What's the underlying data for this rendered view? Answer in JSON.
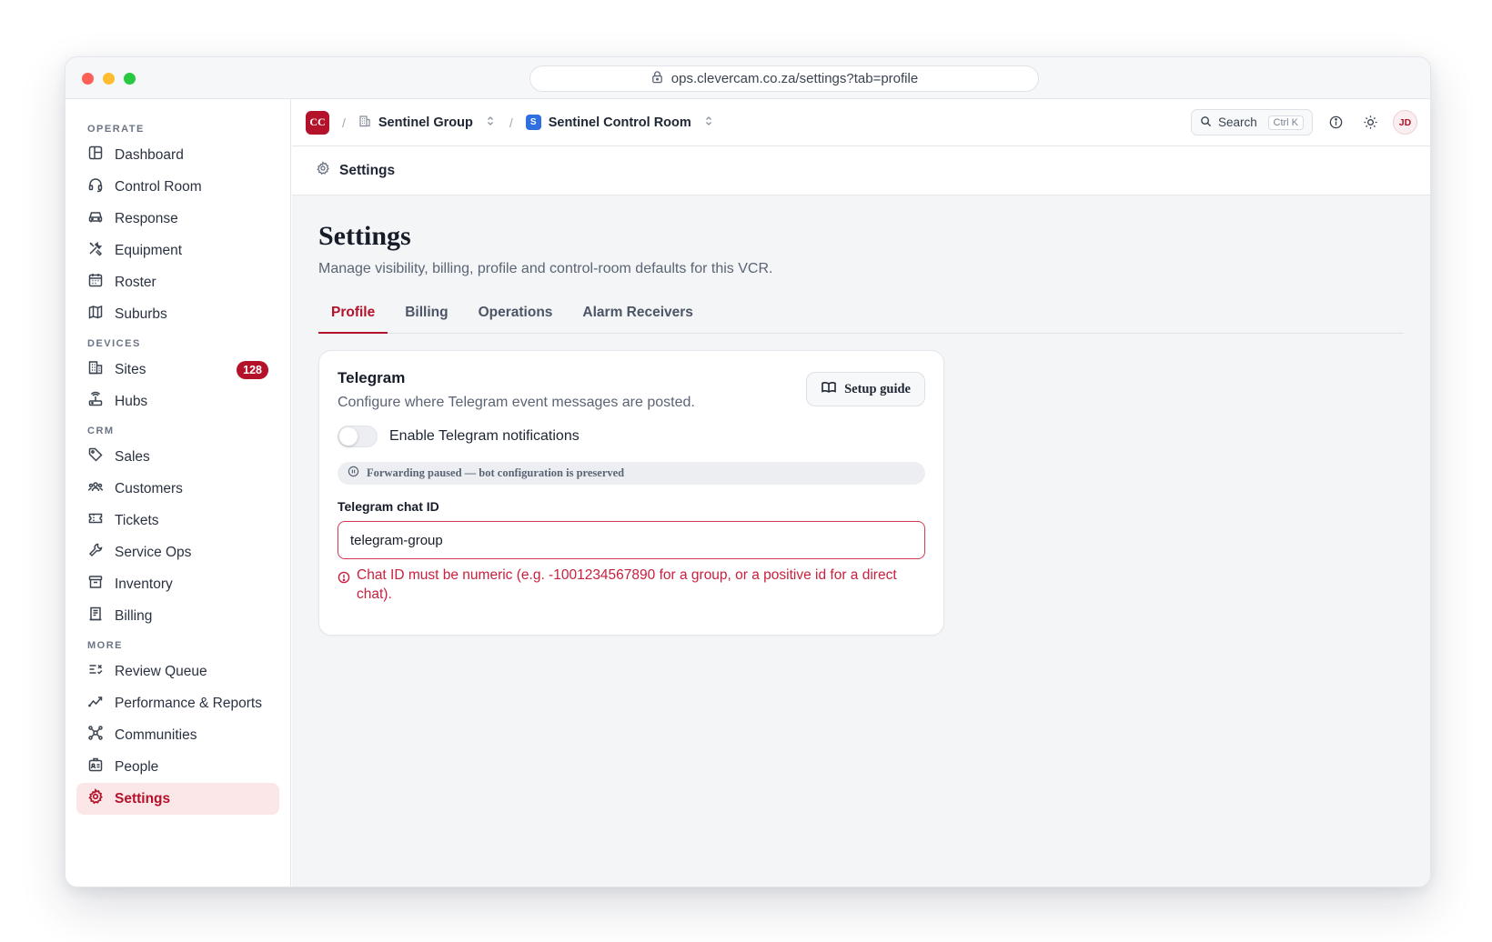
{
  "browser": {
    "url": "ops.clevercam.co.za/settings?tab=profile"
  },
  "sidebar": {
    "sections": [
      {
        "label": "OPERATE",
        "items": [
          {
            "label": "Dashboard",
            "icon": "dashboard-icon"
          },
          {
            "label": "Control Room",
            "icon": "headset-icon"
          },
          {
            "label": "Response",
            "icon": "car-icon"
          },
          {
            "label": "Equipment",
            "icon": "tools-icon"
          },
          {
            "label": "Roster",
            "icon": "calendar-icon"
          },
          {
            "label": "Suburbs",
            "icon": "map-icon"
          }
        ]
      },
      {
        "label": "DEVICES",
        "items": [
          {
            "label": "Sites",
            "icon": "building-icon",
            "badge": "128"
          },
          {
            "label": "Hubs",
            "icon": "router-icon"
          }
        ]
      },
      {
        "label": "CRM",
        "items": [
          {
            "label": "Sales",
            "icon": "tag-icon"
          },
          {
            "label": "Customers",
            "icon": "users-icon"
          },
          {
            "label": "Tickets",
            "icon": "ticket-icon"
          },
          {
            "label": "Service Ops",
            "icon": "wrench-icon"
          },
          {
            "label": "Inventory",
            "icon": "archive-icon"
          },
          {
            "label": "Billing",
            "icon": "receipt-icon"
          }
        ]
      },
      {
        "label": "MORE",
        "items": [
          {
            "label": "Review Queue",
            "icon": "list-check-icon"
          },
          {
            "label": "Performance & Reports",
            "icon": "trend-icon"
          },
          {
            "label": "Communities",
            "icon": "network-icon"
          },
          {
            "label": "People",
            "icon": "id-badge-icon"
          },
          {
            "label": "Settings",
            "icon": "gear-icon",
            "active": true
          }
        ]
      }
    ]
  },
  "topbar": {
    "org_logo": "CC",
    "org_name": "Sentinel Group",
    "room_logo": "S",
    "room_name": "Sentinel Control Room",
    "separator": "/",
    "search_label": "Search",
    "search_shortcut": "Ctrl K",
    "avatar_initials": "JD"
  },
  "pagebar": {
    "title": "Settings"
  },
  "page": {
    "title": "Settings",
    "subtitle": "Manage visibility, billing, profile and control-room defaults for this VCR.",
    "tabs": [
      {
        "label": "Profile",
        "active": true
      },
      {
        "label": "Billing"
      },
      {
        "label": "Operations"
      },
      {
        "label": "Alarm Receivers"
      }
    ]
  },
  "card": {
    "title": "Telegram",
    "subtitle": "Configure where Telegram event messages are posted.",
    "guide_button": "Setup guide",
    "toggle_label": "Enable Telegram notifications",
    "toggle_on": false,
    "status": "Forwarding paused — bot configuration is preserved",
    "field_label": "Telegram chat ID",
    "field_value": "telegram-group",
    "error": "Chat ID must be numeric (e.g. -1001234567890 for a group, or a positive id for a direct chat)."
  },
  "colors": {
    "accent": "#b3122a",
    "error": "#c8203e",
    "room_logo": "#2f6fe0"
  }
}
